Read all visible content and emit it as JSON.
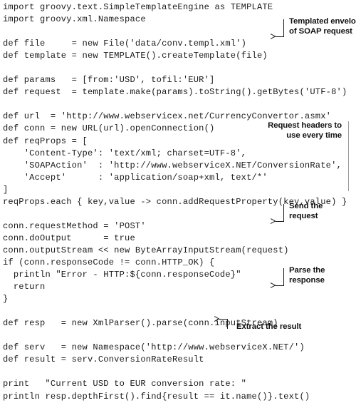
{
  "listing": {
    "language": "groovy",
    "code_lines": [
      "import groovy.text.SimpleTemplateEngine as TEMPLATE",
      "import groovy.xml.Namespace",
      "",
      "def file     = new File('data/conv.templ.xml')",
      "def template = new TEMPLATE().createTemplate(file)",
      "",
      "def params   = [from:'USD', tofil:'EUR']",
      "def request  = template.make(params).toString().getBytes('UTF-8')",
      "",
      "def url  = 'http://www.webservicex.net/CurrencyConvertor.asmx'",
      "def conn = new URL(url).openConnection()",
      "def reqProps = [",
      "    'Content-Type': 'text/xml; charset=UTF-8',",
      "    'SOAPAction'  : 'http://www.webserviceX.NET/ConversionRate',",
      "    'Accept'      : 'application/soap+xml, text/*'",
      "]",
      "reqProps.each { key,value -> conn.addRequestProperty(key,value) }",
      "",
      "conn.requestMethod = 'POST'",
      "conn.doOutput      = true",
      "conn.outputStream << new ByteArrayInputStream(request)",
      "if (conn.responseCode != conn.HTTP_OK) {",
      "  println \"Error - HTTP:${conn.responseCode}\"",
      "  return",
      "}",
      "",
      "def resp   = new XmlParser().parse(conn.inputStream)",
      "",
      "def serv   = new Namespace('http://www.webserviceX.NET/')",
      "def result = serv.ConversionRateResult",
      "",
      "print   \"Current USD to EUR conversion rate: \"",
      "println resp.depthFirst().find{result == it.name()}.text()"
    ]
  },
  "callouts": [
    {
      "id": "templated-envelope",
      "lines": [
        "Templated envelope",
        "of SOAP request"
      ],
      "align": "left",
      "has_arrow": true
    },
    {
      "id": "request-headers",
      "lines": [
        "Request headers to",
        "use every time"
      ],
      "align": "right",
      "has_arrow": false
    },
    {
      "id": "send-the-request",
      "lines": [
        "Send the",
        "request"
      ],
      "align": "left",
      "has_arrow": true
    },
    {
      "id": "parse-the-response",
      "lines": [
        "Parse the",
        "response"
      ],
      "align": "left",
      "has_arrow": true
    },
    {
      "id": "extract-the-result",
      "lines": [
        "Extract the result"
      ],
      "align": "left",
      "has_arrow": true
    }
  ],
  "colors": {
    "code_text": "#1b1b1b",
    "callout_text": "#111111",
    "leader_line": "#1b1b1b",
    "margin_rule": "#9b9b9b",
    "background": "#ffffff"
  }
}
